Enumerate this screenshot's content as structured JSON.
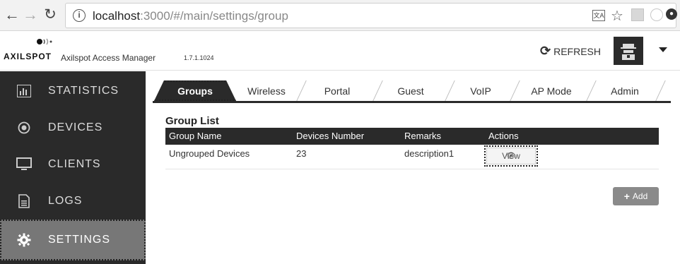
{
  "browser": {
    "url_host": "localhost",
    "url_rest": ":3000/#/main/settings/group",
    "info_icon": "ⓘ"
  },
  "header": {
    "logo_text": "AXILSPOT",
    "app_name": "Axilspot Access Manager",
    "version": "1.7.1.1024",
    "refresh_label": "REFRESH"
  },
  "sidebar": {
    "items": [
      {
        "label": "STATISTICS",
        "icon": "bar-chart-icon"
      },
      {
        "label": "DEVICES",
        "icon": "target-icon"
      },
      {
        "label": "CLIENTS",
        "icon": "monitor-icon"
      },
      {
        "label": "LOGS",
        "icon": "document-icon"
      },
      {
        "label": "SETTINGS",
        "icon": "gear-icon",
        "active": true
      }
    ]
  },
  "tabs": [
    "Groups",
    "Wireless",
    "Portal",
    "Guest",
    "VoIP",
    "AP Mode",
    "Admin"
  ],
  "group_list": {
    "title": "Group List",
    "columns": [
      "Group Name",
      "Devices Number",
      "Remarks",
      "Actions"
    ],
    "rows": [
      {
        "name": "Ungrouped Devices",
        "devices": "23",
        "remarks": "description1",
        "action": "View"
      }
    ],
    "add_label": "Add"
  },
  "colors": {
    "sidebar_bg": "#2a2a2a",
    "active_item": "#777777",
    "add_button": "#8a8a8a"
  }
}
